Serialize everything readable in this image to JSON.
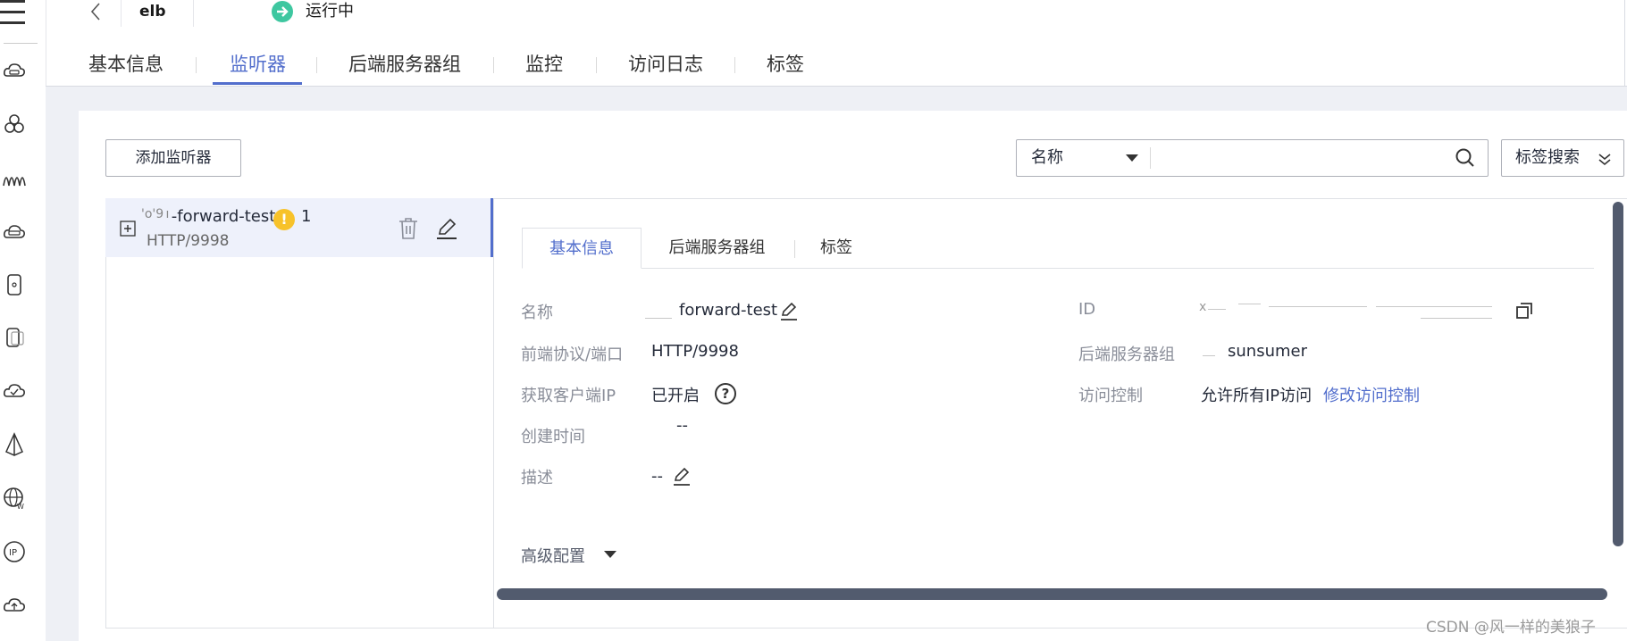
{
  "topbar": {
    "instance_name": "elb",
    "status_text": "运行中",
    "status_color": "#3ec7a0"
  },
  "rail_icons": [
    "cloud-server-icon",
    "cluster-icon",
    "wave-icon",
    "cloud-disk-icon",
    "phone-icon",
    "device-icon",
    "cloud-check-icon",
    "prism-icon",
    "globe-icon",
    "ip-icon",
    "cloud-up-icon"
  ],
  "tabs": [
    "基本信息",
    "监听器",
    "后端服务器组",
    "监控",
    "访问日志",
    "标签"
  ],
  "active_tab": "监听器",
  "toolbar": {
    "add_listener": "添加监听器",
    "search_select": "名称",
    "search_placeholder": "",
    "tag_search": "标签搜索"
  },
  "listeners": [
    {
      "name_prefix": "'o'9 ı ",
      "name": "-forward-test",
      "warning_count": "1",
      "warning_mark": "!",
      "protocol": "HTTP/9998"
    }
  ],
  "detail_tabs": [
    "基本信息",
    "后端服务器组",
    "标签"
  ],
  "detail": {
    "name_label": "名称",
    "name_value": "forward-test",
    "protocol_label": "前端协议/端口",
    "protocol_value": "HTTP/9998",
    "client_ip_label": "获取客户端IP",
    "client_ip_value": "已开启",
    "help_mark": "?",
    "created_label": "创建时间",
    "created_value": "--",
    "desc_label": "描述",
    "desc_value": "--",
    "id_label": "ID",
    "id_value_prefix": "x",
    "backend_label": "后端服务器组",
    "backend_value": "sunsumer",
    "acl_label": "访问控制",
    "acl_value": "允许所有IP访问",
    "acl_link": "修改访问控制",
    "advanced": "高级配置"
  },
  "watermark": "CSDN @风一样的美狼子",
  "colors": {
    "accent": "#526ecc",
    "warning": "#f7c22a",
    "background_gray": "#eef0f5",
    "scrollbar": "#525b6e"
  }
}
